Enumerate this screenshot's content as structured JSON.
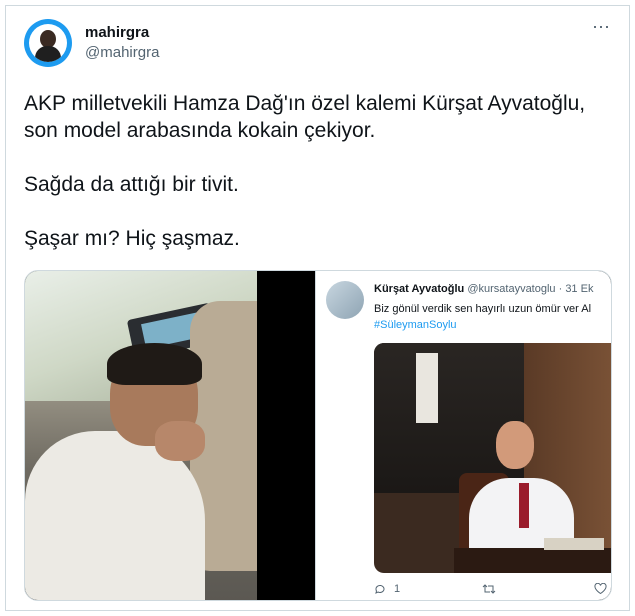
{
  "tweet": {
    "display_name": "mahirgra",
    "handle": "@mahirgra",
    "more_icon": "⋯",
    "lines": [
      "AKP milletvekili Hamza Dağ'ın özel kalemi Kürşat Ayvatoğlu, son model arabasında kokain çekiyor.",
      "Sağda da attığı bir tivit.",
      "Şaşar mı? Hiç şaşmaz."
    ]
  },
  "embed": {
    "name": "Kürşat Ayvatoğlu",
    "handle": "@kursatayvatoglu · 31 Ek",
    "text": "Biz gönül verdik sen hayırlı uzun ömür ver Al",
    "hashtag": "#SüleymanSoylu",
    "reply_count": "1",
    "reply_icon": "reply-icon",
    "retweet_icon": "retweet-icon",
    "like_icon": "heart-icon"
  },
  "colors": {
    "accent": "#1d9bf0",
    "text": "#0f1419",
    "muted": "#536471"
  }
}
